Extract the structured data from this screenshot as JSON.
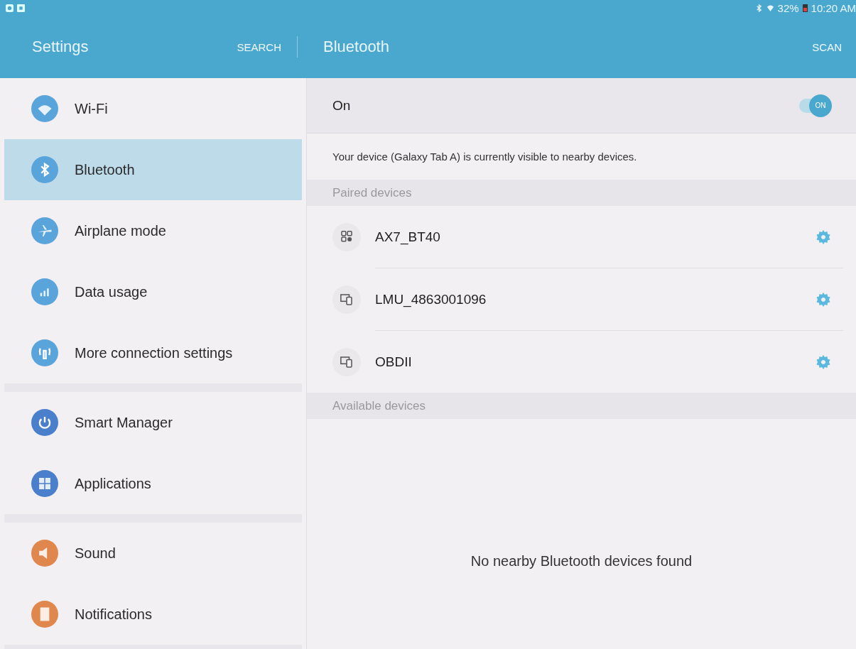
{
  "status_bar": {
    "battery": "32%",
    "time": "10:20 AM"
  },
  "header": {
    "title": "Settings",
    "search": "SEARCH",
    "page_title": "Bluetooth",
    "scan": "SCAN"
  },
  "sidebar": {
    "groups": [
      {
        "items": [
          {
            "label": "Wi-Fi",
            "kind": "wifi",
            "color": "#5aa4dc",
            "selected": false
          },
          {
            "label": "Bluetooth",
            "kind": "bluetooth",
            "color": "#5aa4dc",
            "selected": true
          },
          {
            "label": "Airplane mode",
            "kind": "airplane",
            "color": "#5aa4dc",
            "selected": false
          },
          {
            "label": "Data usage",
            "kind": "bars",
            "color": "#5aa4dc",
            "selected": false
          },
          {
            "label": "More connection settings",
            "kind": "antenna",
            "color": "#5aa4dc",
            "selected": false
          }
        ]
      },
      {
        "items": [
          {
            "label": "Smart Manager",
            "kind": "power",
            "color": "#4a7fcc",
            "selected": false
          },
          {
            "label": "Applications",
            "kind": "grid",
            "color": "#4a7fcc",
            "selected": false
          }
        ]
      },
      {
        "items": [
          {
            "label": "Sound",
            "kind": "speaker",
            "color": "#e0874e",
            "selected": false
          },
          {
            "label": "Notifications",
            "kind": "note",
            "color": "#e0874e",
            "selected": false
          }
        ]
      }
    ]
  },
  "bluetooth": {
    "switch_label": "On",
    "on": true,
    "switch_text": "ON",
    "visibility_note": "Your device (Galaxy Tab A) is currently visible to nearby devices.",
    "paired_header": "Paired devices",
    "paired": [
      {
        "name": "AX7_BT40",
        "kind": "generic"
      },
      {
        "name": "LMU_4863001096",
        "kind": "computer"
      },
      {
        "name": "OBDII",
        "kind": "computer"
      }
    ],
    "available_header": "Available devices",
    "empty_message": "No nearby Bluetooth devices found"
  }
}
